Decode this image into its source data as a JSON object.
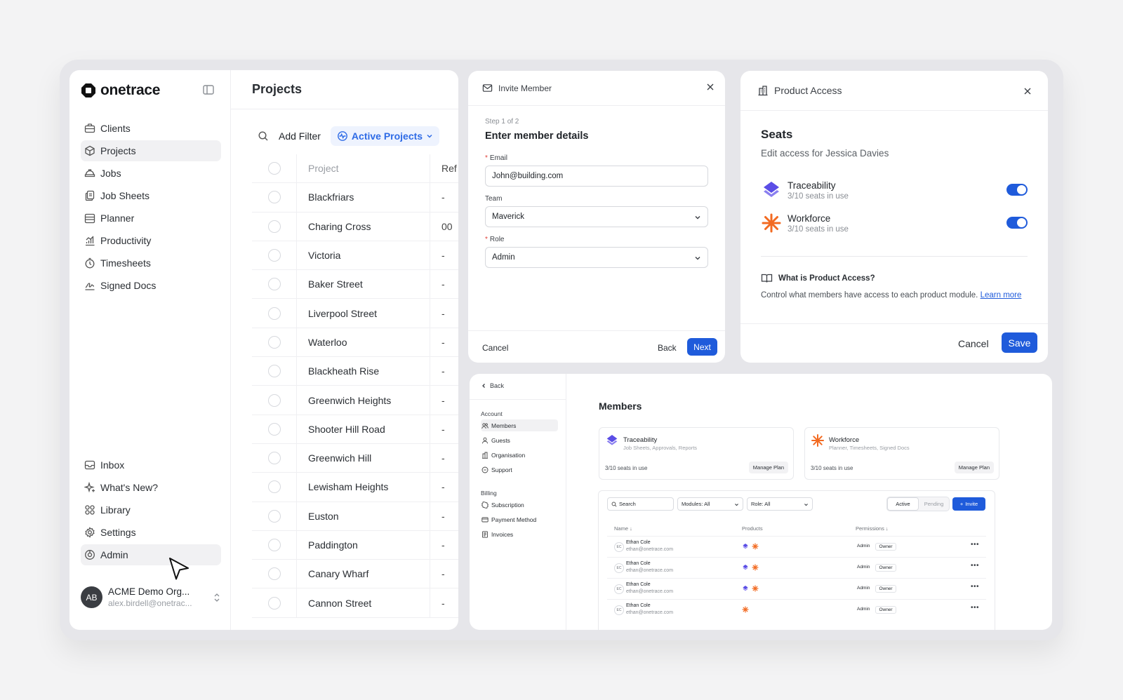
{
  "colors": {
    "brand_blue": "#1f5bdb",
    "traceability_purple": "#5b4ee6",
    "workforce_orange": "#f26a21",
    "active_pill_bg": "#eef3fe"
  },
  "sidebar": {
    "logo": "onetrace",
    "main_items": [
      {
        "label": "Clients",
        "icon": "briefcase-icon"
      },
      {
        "label": "Projects",
        "icon": "cube-icon",
        "active": true
      },
      {
        "label": "Jobs",
        "icon": "hardhat-icon"
      },
      {
        "label": "Job Sheets",
        "icon": "documents-icon"
      },
      {
        "label": "Planner",
        "icon": "calendar-icon"
      },
      {
        "label": "Productivity",
        "icon": "chart-icon"
      },
      {
        "label": "Timesheets",
        "icon": "clock-icon"
      },
      {
        "label": "Signed Docs",
        "icon": "signature-icon"
      }
    ],
    "bottom_items": [
      {
        "label": "Inbox",
        "icon": "inbox-icon"
      },
      {
        "label": "What's New?",
        "icon": "sparkle-icon"
      },
      {
        "label": "Library",
        "icon": "grid-icon"
      },
      {
        "label": "Settings",
        "icon": "gear-icon"
      },
      {
        "label": "Admin",
        "icon": "admin-icon",
        "active": true
      }
    ],
    "account": {
      "initials": "AB",
      "name": "ACME Demo Org...",
      "email": "alex.birdell@onetrac..."
    }
  },
  "projects": {
    "title": "Projects",
    "add_filter": "Add Filter",
    "active_filter": "Active Projects",
    "columns": {
      "project": "Project",
      "ref": "Ref"
    },
    "rows": [
      {
        "name": "Blackfriars",
        "ref": "-"
      },
      {
        "name": "Charing Cross",
        "ref": "00"
      },
      {
        "name": "Victoria",
        "ref": "-"
      },
      {
        "name": "Baker Street",
        "ref": "-"
      },
      {
        "name": "Liverpool Street",
        "ref": "-"
      },
      {
        "name": "Waterloo",
        "ref": "-"
      },
      {
        "name": "Blackheath Rise",
        "ref": "-"
      },
      {
        "name": "Greenwich Heights",
        "ref": "-"
      },
      {
        "name": "Shooter Hill Road",
        "ref": "-"
      },
      {
        "name": "Greenwich Hill",
        "ref": "-"
      },
      {
        "name": "Lewisham Heights",
        "ref": "-"
      },
      {
        "name": "Euston",
        "ref": "-"
      },
      {
        "name": "Paddington",
        "ref": "-"
      },
      {
        "name": "Canary Wharf",
        "ref": "-"
      },
      {
        "name": "Cannon Street",
        "ref": "-"
      }
    ]
  },
  "invite": {
    "title": "Invite Member",
    "step": "Step 1 of 2",
    "heading": "Enter member details",
    "email_label": "Email",
    "email_value": "John@building.com",
    "team_label": "Team",
    "team_value": "Maverick",
    "role_label": "Role",
    "role_value": "Admin",
    "cancel": "Cancel",
    "back": "Back",
    "next": "Next"
  },
  "access": {
    "title": "Product Access",
    "heading": "Seats",
    "subtitle": "Edit access for Jessica Davies",
    "products": [
      {
        "name": "Traceability",
        "seats": "3/10 seats in use",
        "enabled": true
      },
      {
        "name": "Workforce",
        "seats": "3/10 seats in use",
        "enabled": true
      }
    ],
    "info_title": "What is Product Access?",
    "info_text": "Control what members have access to each product module.",
    "learn_more": "Learn more",
    "cancel": "Cancel",
    "save": "Save"
  },
  "members": {
    "back": "Back",
    "account_group": "Account",
    "account_items": [
      "Members",
      "Guests",
      "Organisation",
      "Support"
    ],
    "billing_group": "Billing",
    "billing_items": [
      "Subscription",
      "Payment Method",
      "Invoices"
    ],
    "title": "Members",
    "product_cards": [
      {
        "name": "Traceability",
        "desc": "Job Sheets, Approvals, Reports",
        "seats": "3/10 seats in use",
        "manage": "Manage Plan"
      },
      {
        "name": "Workforce",
        "desc": "Planner, Timesheets, Signed Docs",
        "seats": "3/10 seats in use",
        "manage": "Manage Plan"
      }
    ],
    "search_placeholder": "Search",
    "modules_filter": "Modules: All",
    "role_filter": "Role: All",
    "tab_active": "Active",
    "tab_pending": "Pending",
    "invite": "Invite",
    "col_name": "Name ↓",
    "col_products": "Products",
    "col_permissions": "Permissions ↓",
    "rows": [
      {
        "initials": "EC",
        "name": "Ethan Cole",
        "email": "ethan@onetrace.com",
        "products": [
          "traceability",
          "workforce"
        ],
        "role": "Admin",
        "badge": "Owner"
      },
      {
        "initials": "EC",
        "name": "Ethan Cole",
        "email": "ethan@onetrace.com",
        "products": [
          "traceability",
          "workforce"
        ],
        "role": "Admin",
        "badge": "Owner"
      },
      {
        "initials": "EC",
        "name": "Ethan Cole",
        "email": "ethan@onetrace.com",
        "products": [
          "traceability",
          "workforce"
        ],
        "role": "Admin",
        "badge": "Owner"
      },
      {
        "initials": "EC",
        "name": "Ethan Cole",
        "email": "ethan@onetrace.com",
        "products": [
          "workforce"
        ],
        "role": "Admin",
        "badge": "Owner"
      }
    ]
  }
}
